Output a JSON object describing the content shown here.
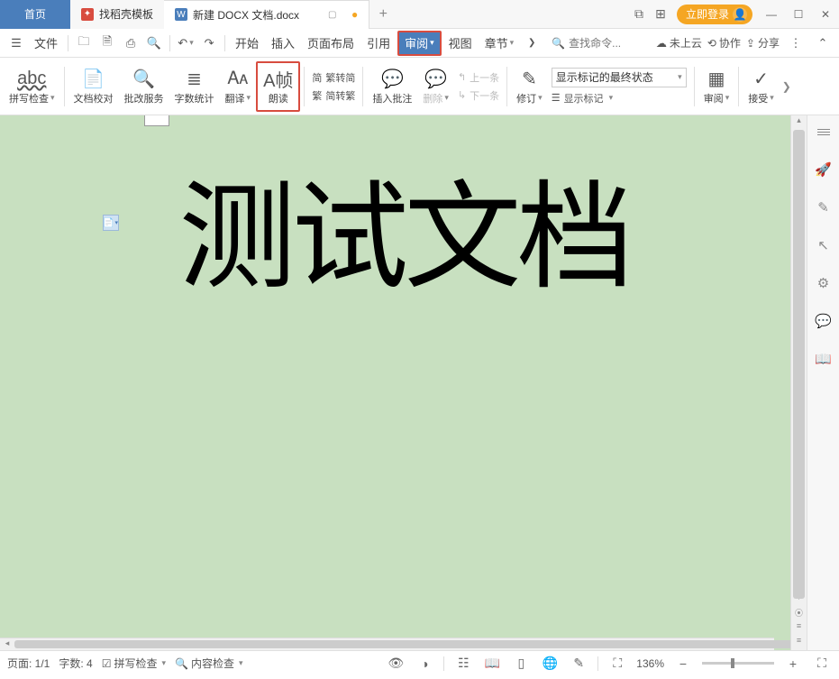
{
  "tabs": {
    "home": "首页",
    "template": "找稻壳模板",
    "doc": "新建 DOCX 文档.docx"
  },
  "login": "立即登录",
  "quickaccess": {
    "file": "文件"
  },
  "menu": {
    "start": "开始",
    "insert": "插入",
    "layout": "页面布局",
    "reference": "引用",
    "review": "审阅",
    "view": "视图",
    "chapter": "章节",
    "search_placeholder": "查找命令...",
    "cloud": "未上云",
    "collab": "协作",
    "share": "分享"
  },
  "ribbon": {
    "spellcheck": "拼写检查",
    "proofread": "文档校对",
    "approve_svc": "批改服务",
    "wordcount": "字数统计",
    "translate": "翻译",
    "readaloud": "朗读",
    "t2s": "繁转简",
    "s2t": "简转繁",
    "insert_comment": "插入批注",
    "delete": "删除",
    "prev": "上一条",
    "next": "下一条",
    "revise": "修订",
    "markup_state": "显示标记的最终状态",
    "show_markup": "显示标记",
    "review_pane": "审阅",
    "accept": "接受"
  },
  "document": {
    "content": "测试文档"
  },
  "status": {
    "page": "页面: 1/1",
    "words": "字数: 4",
    "spell": "拼写检查",
    "content": "内容检查",
    "zoom": "136%"
  }
}
